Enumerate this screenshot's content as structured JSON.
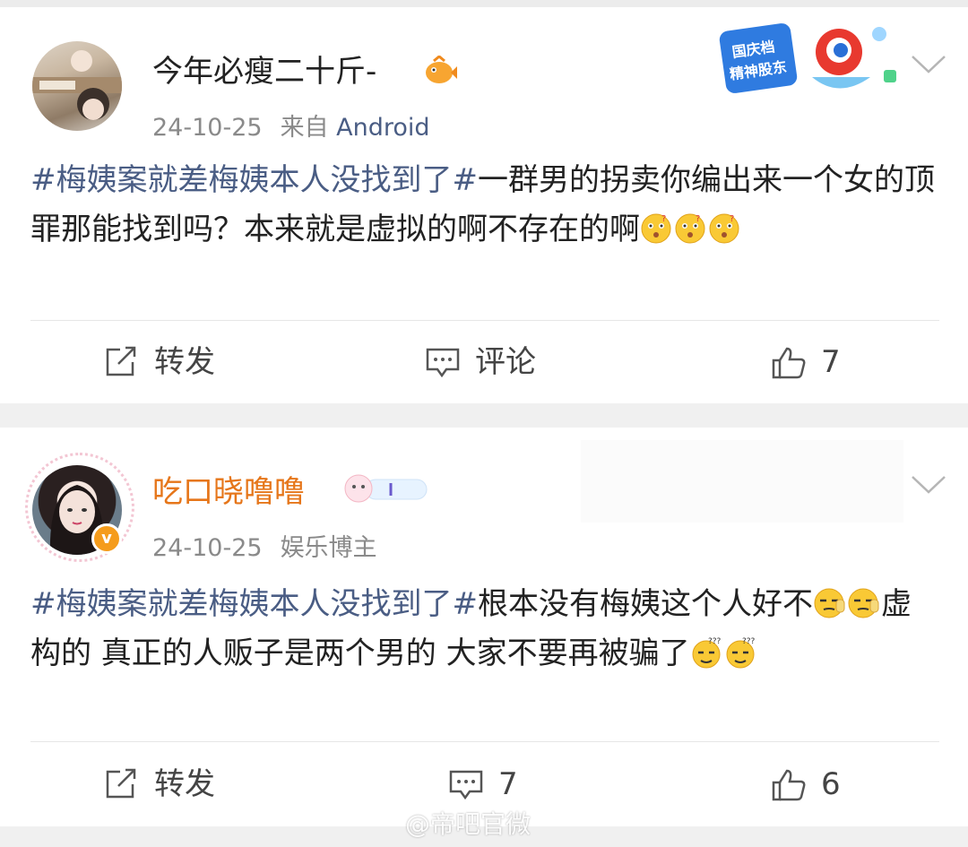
{
  "posts": [
    {
      "username": "今年必瘦二十斤-",
      "date": "24-10-25",
      "source_prefix": "来自",
      "source_name": "Android",
      "badge": "国庆档 精神股东",
      "hashtag": "#梅姨案就差梅姨本人没找到了#",
      "text": "一群男的拐卖你编出来一个女的顶罪那能找到吗？本来就是虚拟的啊不存在的啊",
      "actions": {
        "repost": "转发",
        "comment": "评论",
        "likes": "7"
      }
    },
    {
      "username": "吃口晓噜噜",
      "date": "24-10-25",
      "verified_title": "娱乐博主",
      "hashtag": "#梅姨案就差梅姨本人没找到了#",
      "text_part1": "根本没有梅姨这个人好不",
      "text_part2": "虚构的 真正的人贩子是两个男的 大家不要再被骗了",
      "actions": {
        "repost": "转发",
        "comment": "7",
        "likes": "6"
      }
    }
  ],
  "watermark": "@帝吧官微",
  "colors": {
    "link": "#4a5d84",
    "vip_name": "#e6761a",
    "verified": "#f59c1c"
  }
}
